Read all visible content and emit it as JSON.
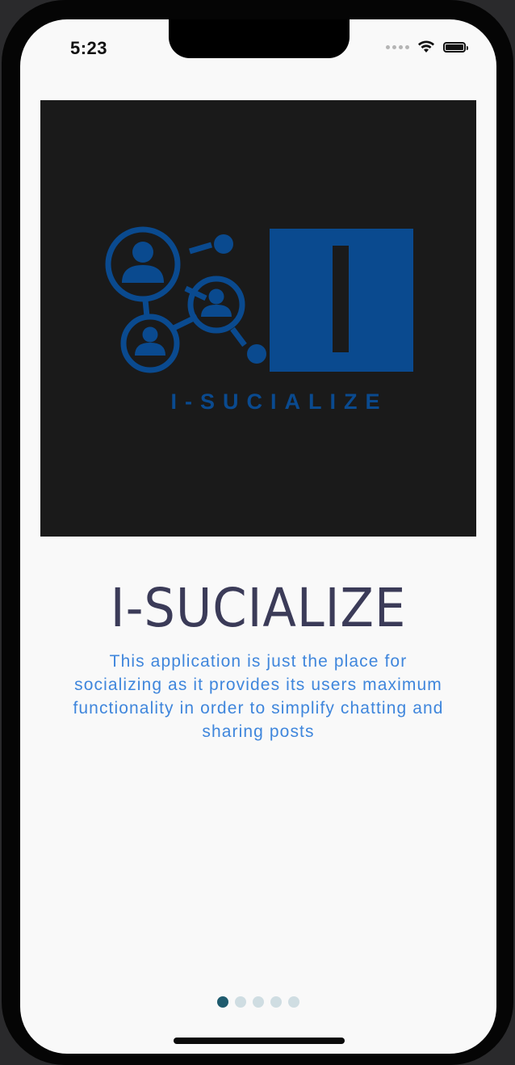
{
  "status_bar": {
    "time": "5:23"
  },
  "hero": {
    "logo_text": "I-SUCIALIZE",
    "logo_letter": "I",
    "brand_color": "#0a4a8f",
    "background": "#1a1a1a"
  },
  "onboarding": {
    "title": "I-SUCIALIZE",
    "description": "This application is just the place for socializing as it provides its users maximum functionality in order to simplify chatting and sharing posts"
  },
  "pager": {
    "total_pages": 5,
    "current_page": 1,
    "active_color": "#1f5b6e",
    "inactive_color": "#cfdde2"
  }
}
